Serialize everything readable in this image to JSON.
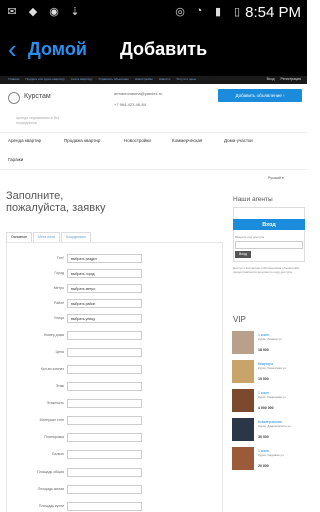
{
  "status_bar": {
    "time": "8:54 PM"
  },
  "app_bar": {
    "back_label": "Домой",
    "title": "Добавить"
  },
  "site_top": {
    "links": [
      "Главная",
      "Продать или сдать квартиру",
      "Снять квартиру",
      "Управлять объектами",
      "Новостройки",
      "Новости",
      "Услуги и цены"
    ],
    "login": "Вход",
    "register": "Регистрация"
  },
  "header": {
    "brand": "Курстам",
    "tagline": "Аренда недвижимости без посредников",
    "email": "armacronasma@yandex.ru",
    "phone": "+7 964-423-46-84",
    "add_button": "Добавить объявление ›"
  },
  "nav": [
    "Аренда квартир",
    "Продажа квартир",
    "Новостройки",
    "Коммерческая",
    "Дома-участки",
    "Гаражи"
  ],
  "language": "Русский",
  "form": {
    "heading": "Заполните, пожалуйста, заявку",
    "tabs": [
      "Основное",
      "Мета поля",
      "Координаты"
    ],
    "fields": [
      {
        "label": "Тип*",
        "value": "выбрать раздел"
      },
      {
        "label": "Город",
        "value": "выбрать город"
      },
      {
        "label": "Метро",
        "value": "выбрать метро"
      },
      {
        "label": "Район",
        "value": "выбрать район"
      },
      {
        "label": "Улица",
        "value": "выбрать улицу"
      },
      {
        "label": "Номер дома",
        "value": ""
      },
      {
        "label": "Цена",
        "value": ""
      },
      {
        "label": "Кол-во комнат",
        "value": ""
      },
      {
        "label": "Этаж",
        "value": ""
      },
      {
        "label": "Этажность",
        "value": ""
      },
      {
        "label": "Материал стен",
        "value": ""
      },
      {
        "label": "Планировка",
        "value": ""
      },
      {
        "label": "Балкон",
        "value": ""
      },
      {
        "label": "Площадь общая",
        "value": ""
      },
      {
        "label": "Площадь жилая",
        "value": ""
      },
      {
        "label": "Площадь кухни",
        "value": ""
      }
    ]
  },
  "sidebar": {
    "agents_title": "Наши агенты",
    "login_button": "Вход",
    "login_hint": "Введите код доступа",
    "login_submit": "Вход",
    "note": "Доступ к контактам собственников объявлений предоставляется агентам по коду доступа.",
    "vip_title": "VIP",
    "vip": [
      {
        "type": "1 комн.",
        "addr": "Курск, Ленина ул.",
        "price": "18 000",
        "color": "#b8a08a"
      },
      {
        "type": "Квартира",
        "addr": "Курск, Советская ул.",
        "price": "15 000",
        "color": "#c9a46a"
      },
      {
        "type": "1 комн.",
        "addr": "Курск, Радищева ул.",
        "price": "4 000 000",
        "color": "#7b4a2e"
      },
      {
        "type": "Коммерческая",
        "addr": "Курск, Дзержинского ул.",
        "price": "30 000",
        "color": "#2b3646"
      },
      {
        "type": "1 комн.",
        "addr": "Курск, Садовая ул.",
        "price": "20 000",
        "color": "#9b5a3a"
      }
    ]
  }
}
